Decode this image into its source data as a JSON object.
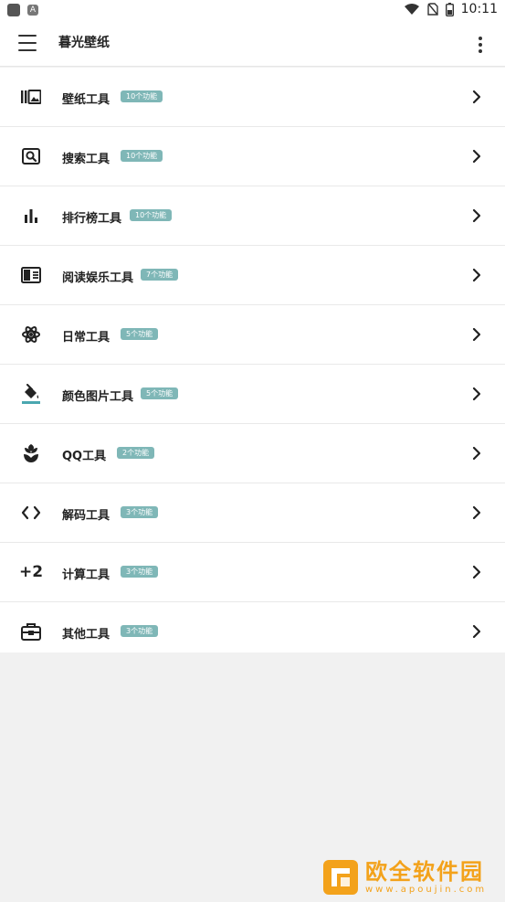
{
  "status_bar": {
    "left_icon_1": "square-app-icon",
    "left_icon_2": "A",
    "time": "10:11",
    "icons": [
      "wifi-icon",
      "no-sim-icon",
      "battery-icon"
    ]
  },
  "app_bar": {
    "menu_icon": "hamburger-icon",
    "title": "暮光壁纸",
    "overflow_icon": "more-vert-icon"
  },
  "colors": {
    "badge_bg": "#7fb7b7",
    "watermark": "#f3a21b"
  },
  "tools": [
    {
      "icon": "wallpaper-icon",
      "label": "壁纸工具",
      "badge": "10个功能"
    },
    {
      "icon": "search-image-icon",
      "label": "搜索工具",
      "badge": "10个功能"
    },
    {
      "icon": "bar-chart-icon",
      "label": "排行榜工具",
      "badge": "10个功能"
    },
    {
      "icon": "book-icon",
      "label": "阅读娱乐工具",
      "badge": "7个功能"
    },
    {
      "icon": "atom-icon",
      "label": "日常工具",
      "badge": "5个功能"
    },
    {
      "icon": "paint-bucket-icon",
      "label": "颜色图片工具",
      "badge": "5个功能"
    },
    {
      "icon": "flower-icon",
      "label": "QQ工具",
      "badge": "2个功能"
    },
    {
      "icon": "code-icon",
      "label": "解码工具",
      "badge": "3个功能"
    },
    {
      "icon": "plus-two-icon",
      "label": "计算工具",
      "badge": "3个功能",
      "icon_text": "+2"
    },
    {
      "icon": "toolbox-icon",
      "label": "其他工具",
      "badge": "3个功能"
    }
  ],
  "watermark": {
    "title": "欧全软件园",
    "url": "www.apoujin.com"
  }
}
